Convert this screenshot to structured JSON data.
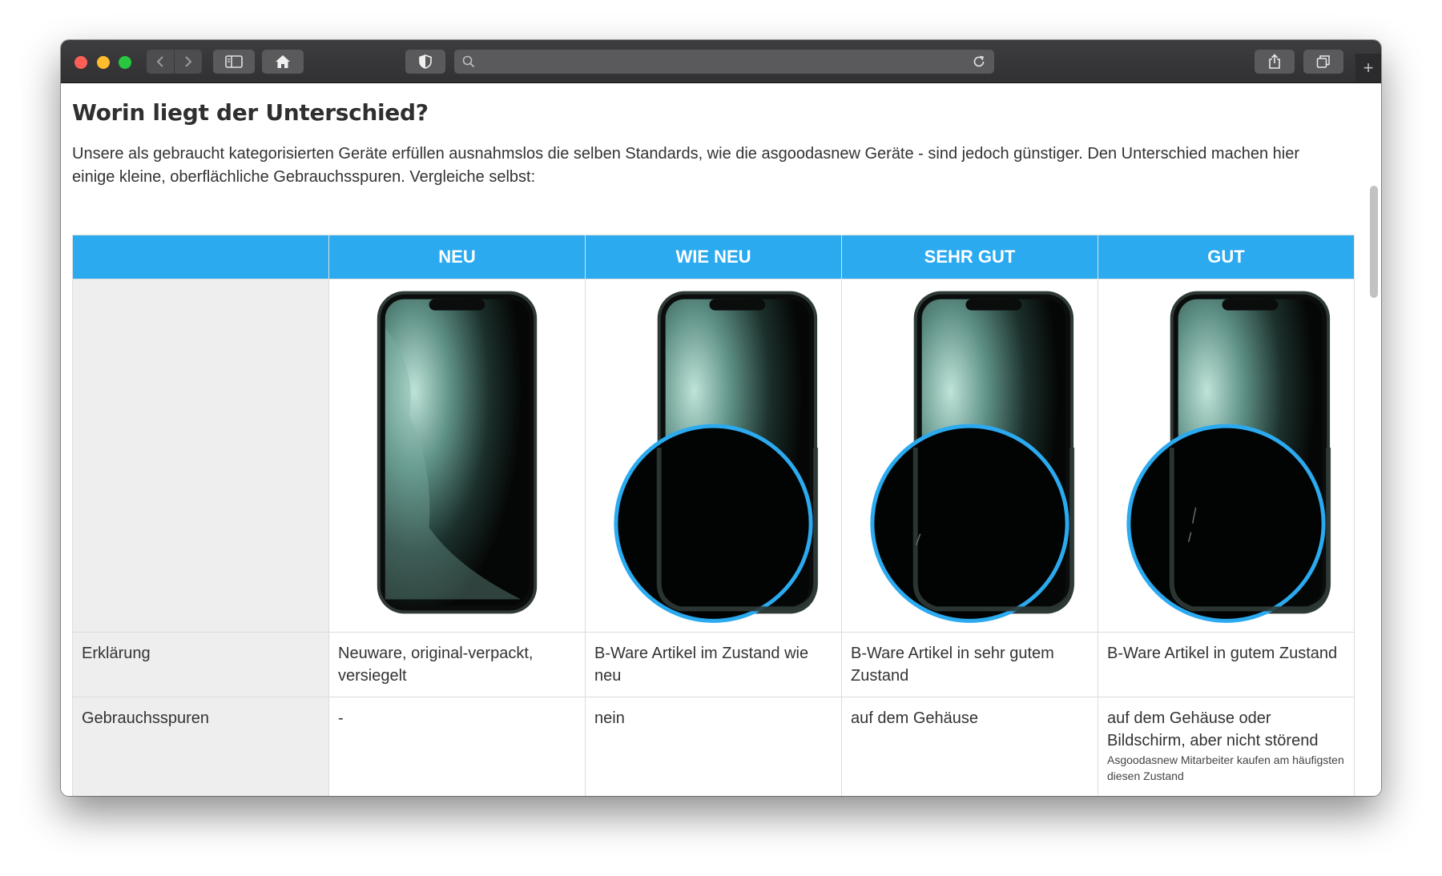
{
  "browser": {
    "address_placeholder": "",
    "icons": [
      "back-icon",
      "forward-icon",
      "sidebar-icon",
      "home-icon",
      "shield-icon",
      "search-icon",
      "reload-icon",
      "share-icon",
      "tabs-icon",
      "new-tab-icon"
    ]
  },
  "page": {
    "heading": "Worin liegt der Unterschied?",
    "intro": "Unsere als gebraucht kategorisierten Geräte erfüllen ausnahmslos die selben Standards, wie die asgoodasnew Geräte - sind jedoch günstiger. Den Unterschied machen hier einige kleine, oberflächliche Gebrauchsspuren. Vergleiche selbst:"
  },
  "table": {
    "headers": [
      "",
      "NEU",
      "WIE NEU",
      "SEHR GUT",
      "GUT"
    ],
    "rows": {
      "erklaerung": {
        "label": "Erklärung",
        "values": [
          "Neuware, original-verpackt, versiegelt",
          "B-Ware Artikel im Zustand wie neu",
          "B-Ware Artikel in sehr gutem Zustand",
          "B-Ware Artikel in gutem Zustand"
        ]
      },
      "gebrauchsspuren": {
        "label": "Gebrauchsspuren",
        "values": [
          "-",
          "nein",
          "auf dem Gehäuse",
          "auf dem Gehäuse oder Bildschirm, aber nicht störend"
        ],
        "note": "Asgoodasnew Mitarbeiter kaufen am häufigsten diesen Zustand"
      }
    },
    "highlight_color": "#2baaf0"
  }
}
